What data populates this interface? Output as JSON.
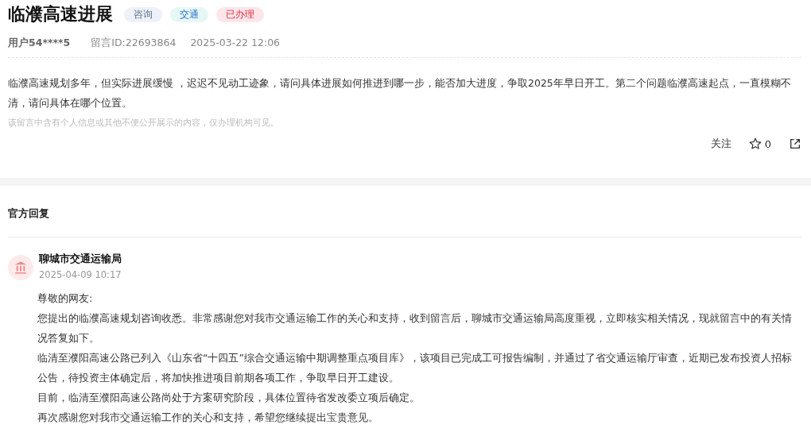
{
  "message": {
    "title": "临濮高速进展",
    "tags": [
      {
        "label": "咨询",
        "kind": "type",
        "color": "#eef2f8"
      },
      {
        "label": "交通",
        "kind": "category",
        "color": "#e6f8f6"
      },
      {
        "label": "已办理",
        "kind": "status",
        "color": "#fde6ea"
      }
    ],
    "user": "用户54****5",
    "message_id": "留言ID:22693864",
    "time": "2025-03-22 12:06",
    "body": "临濮高速规划多年，但实际进展缓慢 ，迟迟不见动工迹象，请问具体进展如何推进到哪一步，能否加大进度，争取2025年早日开工。第二个问题临濮高速起点，一直模糊不清，请问具体在哪个位置。",
    "privacy_note": "该留言中含有个人信息或其他不便公开展示的内容，仅办理机构可见。",
    "actions": {
      "follow": "关注",
      "likes": "0"
    }
  },
  "reply": {
    "heading": "官方回复",
    "agency": "聊城市交通运输局",
    "time": "2025-04-09 10:17",
    "paragraphs": [
      "尊敬的网友:",
      "您提出的临濮高速规划咨询收悉。非常感谢您对我市交通运输工作的关心和支持，收到留言后，聊城市交通运输局高度重视，立即核实相关情况，现就留言中的有关情况答复如下。",
      "临清至濮阳高速公路已列入《山东省“十四五”综合交通运输中期调整重点项目库》，该项目已完成工可报告编制，并通过了省交通运输厅审查，近期已发布投资人招标公告，待投资主体确定后，将加快推进项目前期各项工作，争取早日开工建设。",
      "目前，临清至濮阳高速公路尚处于方案研究阶段，具体位置待省发改委立项后确定。",
      "再次感谢您对我市交通运输工作的关心和支持，希望您继续提出宝贵意见。"
    ]
  }
}
